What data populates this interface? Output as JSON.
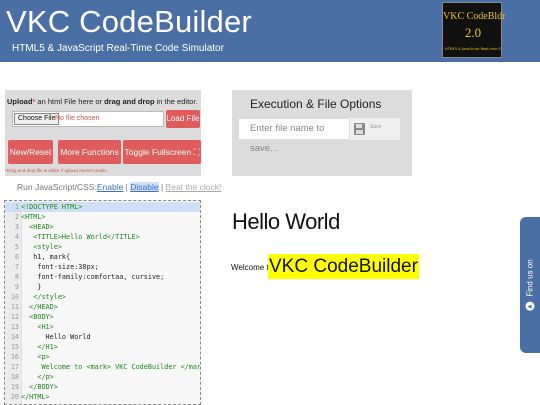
{
  "header": {
    "title": "VKC CodeBuilder",
    "subtitle": "HTML5 & JavaScript Real-Time Code Simulator",
    "logo": {
      "name": "VKC CodeBldr",
      "version": "2.0",
      "tagline": "HTML5 & JavaScript Real-time Simulator"
    }
  },
  "upload": {
    "hint_upload": "Upload",
    "hint_req": "*",
    "hint_mid": " an html File here or ",
    "hint_drag": "drag and drop",
    "hint_end": " in the editor.",
    "choose_label": "Choose File",
    "no_file": "No file chosen",
    "load_label": "Load File",
    "new_reset_label": "New/Reset",
    "more_functions_label": "More Functions",
    "toggle_fullscreen_label": "Toggle Fullscreen ⛶",
    "note": "*Drag and drop file in editor if upload doesn't works."
  },
  "run_js": {
    "prefix": "Run JavaScript/CSS:",
    "enable": "Enable",
    "separator": " | ",
    "disable": "Disable",
    "beat_clock": "Beat the clock!"
  },
  "editor": {
    "lines": [
      {
        "n": "1",
        "text": "<!DOCTYPE HTML>",
        "tag": true
      },
      {
        "n": "2",
        "text": "<HTML>",
        "tag": true
      },
      {
        "n": "3",
        "text": "  <HEAD>",
        "tag": true
      },
      {
        "n": "4",
        "text": "   <TITLE>Hello World</TITLE>",
        "tag": true
      },
      {
        "n": "5",
        "text": "   <style>",
        "tag": true
      },
      {
        "n": "6",
        "text": "   h1, mark{",
        "tag": false
      },
      {
        "n": "7",
        "text": "    font-size:38px;",
        "tag": false
      },
      {
        "n": "8",
        "text": "    font-family:comfortaa, cursive;",
        "tag": false
      },
      {
        "n": "9",
        "text": "    }",
        "tag": false
      },
      {
        "n": "10",
        "text": "   </style>",
        "tag": true
      },
      {
        "n": "11",
        "text": "  </HEAD>",
        "tag": true
      },
      {
        "n": "12",
        "text": "  <BODY>",
        "tag": true
      },
      {
        "n": "13",
        "text": "    <H1>",
        "tag": true
      },
      {
        "n": "14",
        "text": "      Hello World",
        "tag": false
      },
      {
        "n": "15",
        "text": "    </H1>",
        "tag": true
      },
      {
        "n": "16",
        "text": "    <p>",
        "tag": true
      },
      {
        "n": "17",
        "text": "     Welcome to <mark> VKC CodeBuilder </mark>",
        "tag": true
      },
      {
        "n": "18",
        "text": "    </p>",
        "tag": true
      },
      {
        "n": "19",
        "text": "  </BODY>",
        "tag": true
      },
      {
        "n": "20",
        "text": "</HTML>",
        "tag": true
      }
    ]
  },
  "exec": {
    "title": "Execution & File Options",
    "filename_placeholder": "Enter file name to save...",
    "save_label": "Save"
  },
  "preview": {
    "h1": "Hello World",
    "p_text": "Welcome to",
    "mark_text": "VKC CodeBuilder"
  },
  "find_us": {
    "label": "Find us on"
  }
}
